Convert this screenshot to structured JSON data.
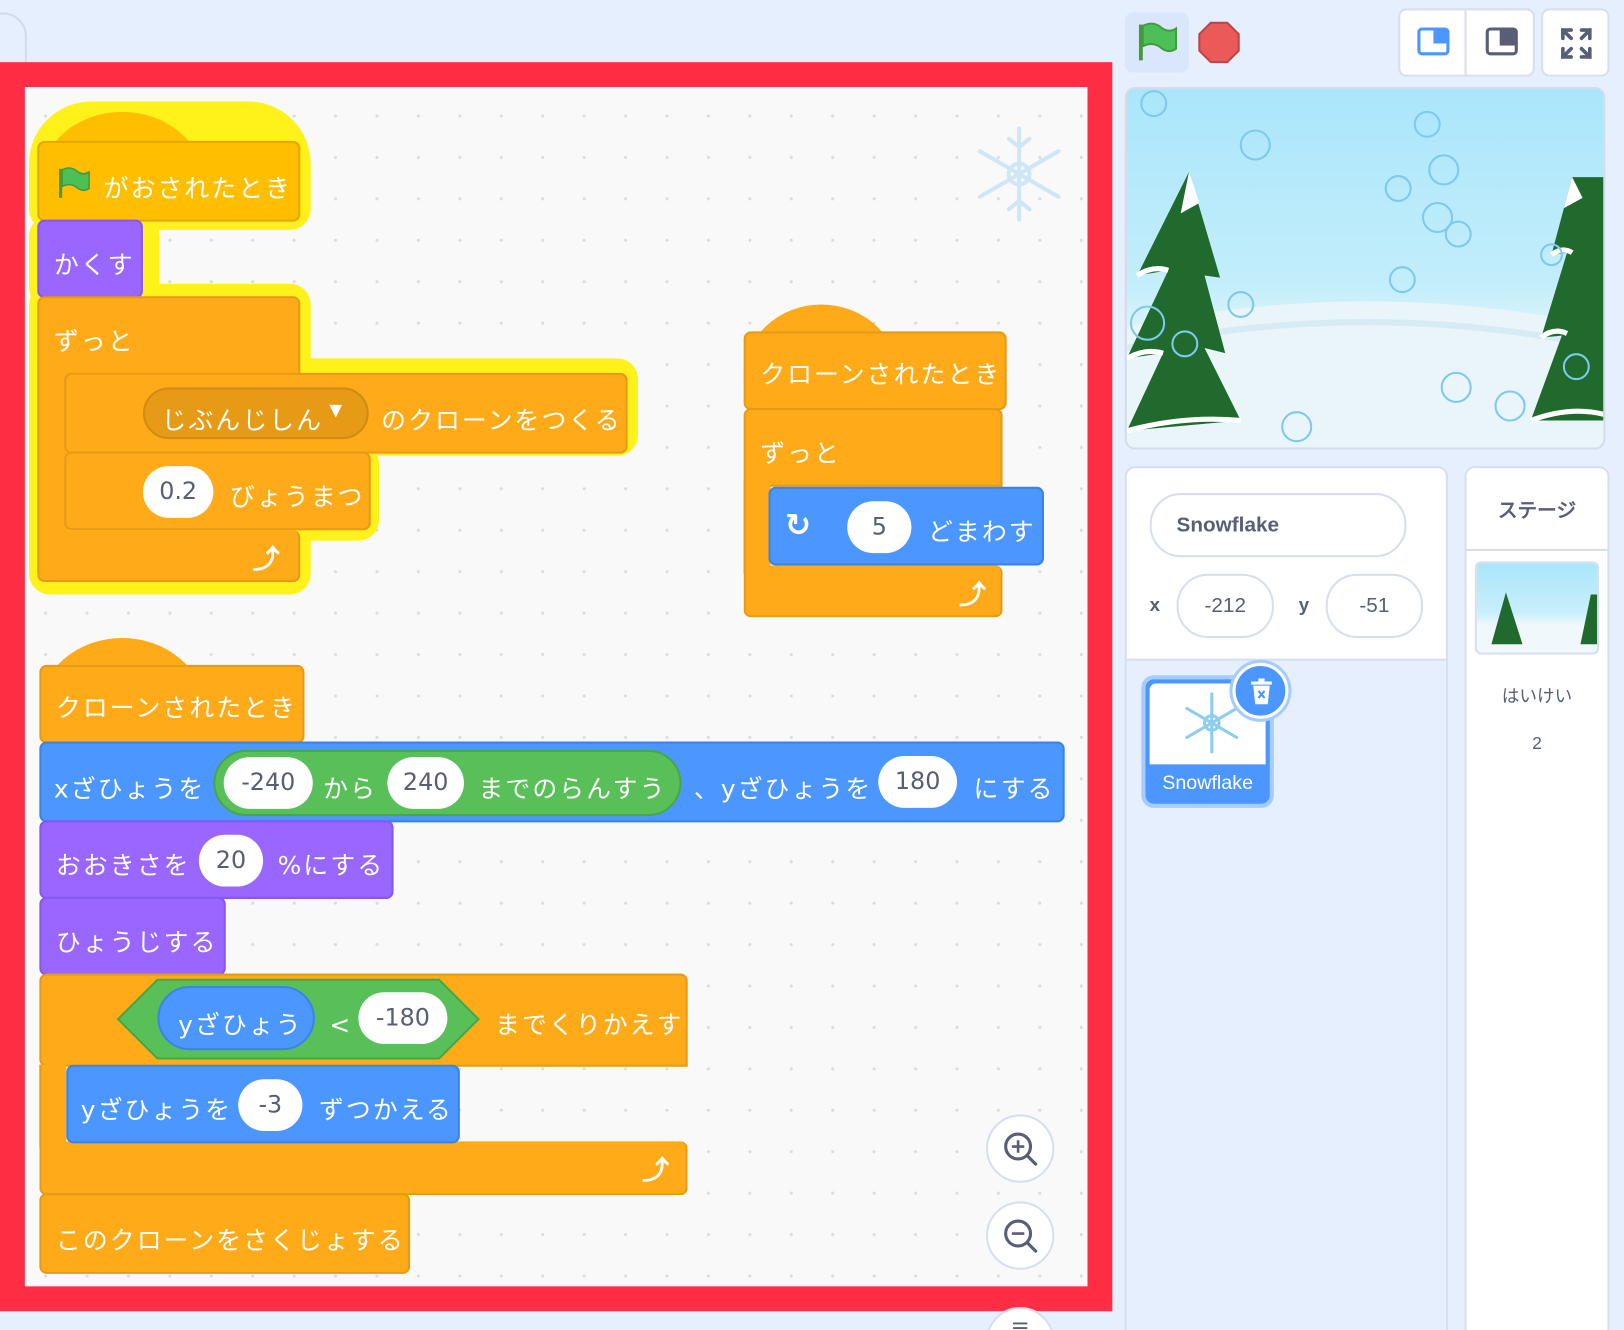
{
  "code": {
    "hat_flag": "がおされたとき",
    "hide": "かくす",
    "forever1": "ずっと",
    "clone_menu": "じぶんじしん",
    "clone_create": "のクローンをつくる",
    "wait_value": "0.2",
    "wait_label": "びょうまつ",
    "clone_hat_right": "クローンされたとき",
    "forever2": "ずっと",
    "turn_value": "5",
    "turn_label": "どまわす",
    "clone_hat_left": "クローンされたとき",
    "set_x_label": "xざひょうを",
    "rand_from": "-240",
    "rand_from_label": "から",
    "rand_to": "240",
    "rand_to_label": "までのらんすう",
    "set_y_label": "、yざひょうを",
    "set_y_value": "180",
    "set_y_suffix": "にする",
    "size_label": "おおきさを",
    "size_value": "20",
    "size_suffix": "%にする",
    "show": "ひょうじする",
    "y_reporter": "yざひょう",
    "lt": "<",
    "cmp_value": "-180",
    "repeat_until": "までくりかえす",
    "change_y_label": "yざひょうを",
    "change_y_value": "-3",
    "change_y_suffix": "ずつかえる",
    "delete_clone": "このクローンをさくじょする"
  },
  "sprite_info": {
    "name": "Snowflake",
    "x_label": "x",
    "x_value": "-212",
    "y_label": "y",
    "y_value": "-51"
  },
  "sprites": [
    {
      "name": "Snowflake"
    }
  ],
  "stage_panel": {
    "title": "ステージ",
    "backdrops_label": "はいけい",
    "backdrops_count": "2"
  },
  "colors": {
    "highlight_frame": "#ff2e45",
    "events": "#ffbf00",
    "control": "#ffab19",
    "looks": "#9966ff",
    "motion": "#4c97ff",
    "operators": "#59c059",
    "green_flag": "#4cbf56",
    "stop": "#ec5959"
  }
}
